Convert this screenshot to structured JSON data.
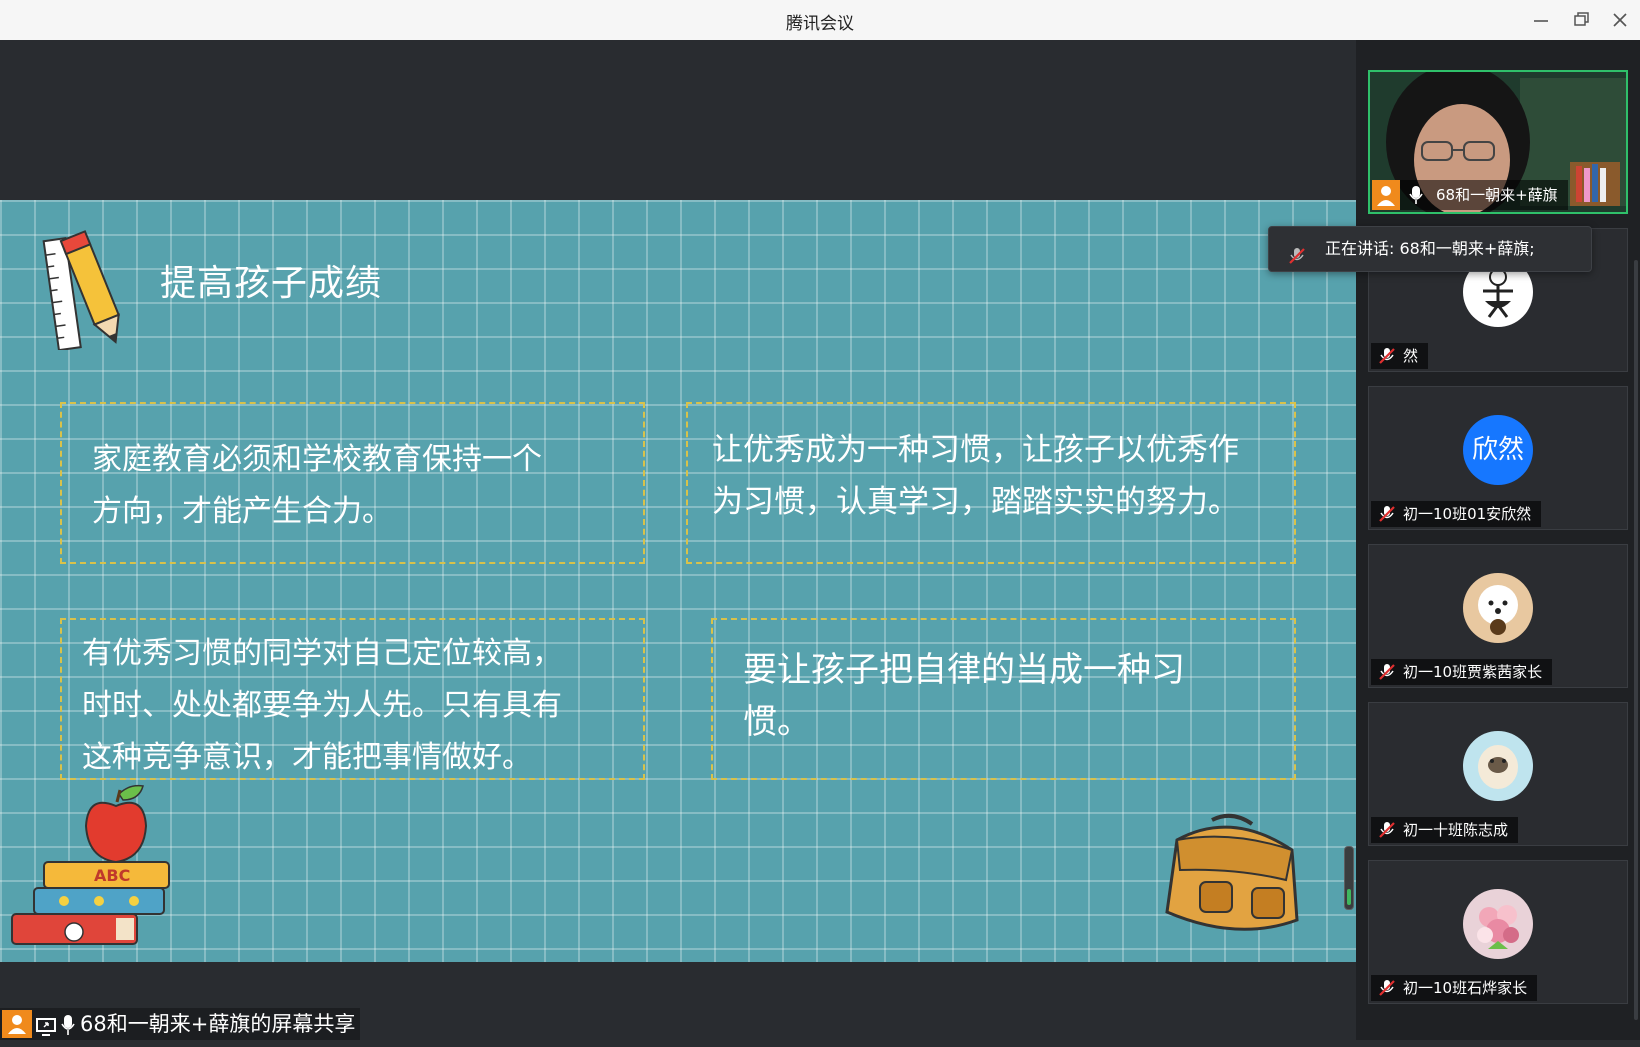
{
  "window": {
    "title": "腾讯会议"
  },
  "slide": {
    "title": "提高孩子成绩",
    "box1": [
      "家庭教育必须和学校教育保持一个",
      "方向，才能产生合力。"
    ],
    "box2": [
      "让优秀成为一种习惯，让孩子以优秀作",
      "为习惯，认真学习，踏踏实实的努力。"
    ],
    "box3": [
      "有优秀习惯的同学对自己定位较高，",
      "时时、处处都要争为人先。只有具有",
      "这种竞争意识，才能把事情做好。"
    ],
    "box4": [
      "要让孩子把自律的当成一种习",
      "惯。"
    ],
    "books_label": "ABC"
  },
  "share": {
    "label": "68和一朝来+薛旗的屏幕共享"
  },
  "speaking": {
    "label": "正在讲话: 68和一朝来+薛旗;"
  },
  "participants": [
    {
      "name": "68和一朝来+薛旗",
      "type": "video"
    },
    {
      "name": "然",
      "type": "image"
    },
    {
      "name": "初一10班01安欣然",
      "type": "text",
      "avatar_text": "欣然",
      "avatar_color": "#1677ff"
    },
    {
      "name": "初一10班贾紫茜家长",
      "type": "image"
    },
    {
      "name": "初一十班陈志成",
      "type": "image"
    },
    {
      "name": "初一10班石烨家长",
      "type": "image"
    }
  ],
  "colors": {
    "slide_bg": "#57a2ad",
    "active_border": "#2fc06a",
    "host_badge": "#f08a1c",
    "dash": "#d9c24a"
  }
}
